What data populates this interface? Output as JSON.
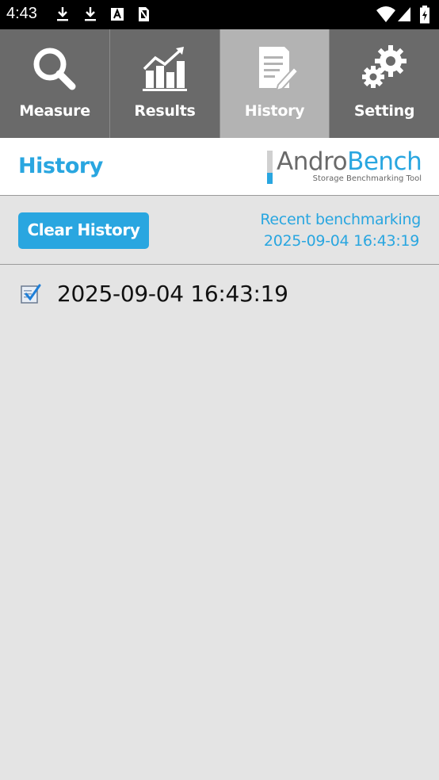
{
  "status_bar": {
    "time": "4:43",
    "left_icons": [
      "download-icon",
      "download-icon",
      "font-icon",
      "no-sim-card-icon"
    ],
    "right_icons": [
      "wifi-icon",
      "signal-icon",
      "battery-icon"
    ]
  },
  "tabs": [
    {
      "label": "Measure",
      "icon": "magnifier-icon",
      "active": false
    },
    {
      "label": "Results",
      "icon": "bar-chart-icon",
      "active": false
    },
    {
      "label": "History",
      "icon": "document-edit-icon",
      "active": true
    },
    {
      "label": "Setting",
      "icon": "gears-icon",
      "active": false
    }
  ],
  "header": {
    "title": "History",
    "logo_part1": "Andro",
    "logo_part2": "Bench",
    "logo_subtitle": "Storage Benchmarking Tool"
  },
  "actions": {
    "clear_label": "Clear History",
    "recent_label": "Recent benchmarking",
    "recent_date": "2025-09-04 16:43:19"
  },
  "history": [
    {
      "date": "2025-09-04 16:43:19",
      "icon": "checked-document-icon"
    }
  ],
  "colors": {
    "accent": "#29a6e0",
    "tab_bar": "#6a6a6a",
    "tab_active": "#b3b3b3",
    "background": "#e4e4e4"
  }
}
